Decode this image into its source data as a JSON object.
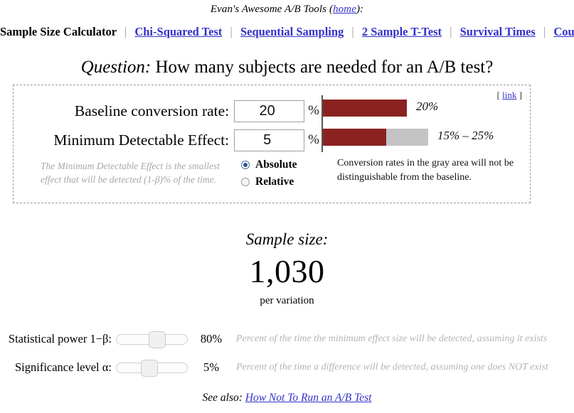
{
  "header": {
    "site_title_prefix": "Evan's Awesome A/B Tools (",
    "home_link": "home",
    "site_title_suffix": "):",
    "nav": [
      {
        "label": "Sample Size Calculator",
        "current": true
      },
      {
        "label": "Chi-Squared Test",
        "current": false
      },
      {
        "label": "Sequential Sampling",
        "current": false
      },
      {
        "label": "2 Sample T-Test",
        "current": false
      },
      {
        "label": "Survival Times",
        "current": false
      },
      {
        "label": "Count Data",
        "current": false
      }
    ],
    "nav_separator": "|"
  },
  "question": {
    "label": "Question:",
    "text": "How many subjects are needed for an A/B test?"
  },
  "calculator": {
    "link_open_bracket": "[",
    "link_label": "link",
    "link_close_bracket": "]",
    "baseline": {
      "label": "Baseline conversion rate:",
      "value": "20",
      "placeholder": "20",
      "unit": "%"
    },
    "mde": {
      "label": "Minimum Detectable Effect:",
      "value": "5",
      "placeholder": "5",
      "unit": "%"
    },
    "mde_note": "The Minimum Detectable Effect is the smallest effect that will be detected (1-β)% of the time.",
    "effect_type": {
      "selected": "Absolute",
      "options": [
        {
          "label": "Absolute",
          "checked": true
        },
        {
          "label": "Relative",
          "checked": false
        }
      ]
    },
    "gray_note": "Conversion rates in the gray area will not be distinguishable from the baseline."
  },
  "chart_data": {
    "type": "bar",
    "title": "",
    "orientation": "horizontal",
    "xlabel": "",
    "ylabel": "",
    "xlim": [
      0,
      50
    ],
    "grid": false,
    "legend": false,
    "colors": {
      "baseline": "#8b2220",
      "range": "#c4c4c4"
    },
    "bars": [
      {
        "name": "baseline",
        "value": 20,
        "caption": "20%",
        "fill_pct": 20,
        "gray_from_pct": null,
        "gray_to_pct": null
      },
      {
        "name": "detectable-range",
        "value": 20,
        "caption": "15% – 25%",
        "fill_pct": 15,
        "gray_from_pct": 15,
        "gray_to_pct": 25
      }
    ]
  },
  "result": {
    "title": "Sample size:",
    "value": "1,030",
    "sub": "per variation"
  },
  "sliders": [
    {
      "label": "Statistical power 1−β:",
      "value": "80%",
      "percent": 80,
      "thumb_pct": 60,
      "description": "Percent of the time the minimum effect size will be detected, assuming it exists"
    },
    {
      "label": "Significance level α:",
      "value": "5%",
      "percent": 5,
      "thumb_pct": 46,
      "description": "Percent of the time a difference will be detected, assuming one does NOT exist"
    }
  ],
  "footer": {
    "see_also": "See also:",
    "link_label": "How Not To Run an A/B Test"
  }
}
